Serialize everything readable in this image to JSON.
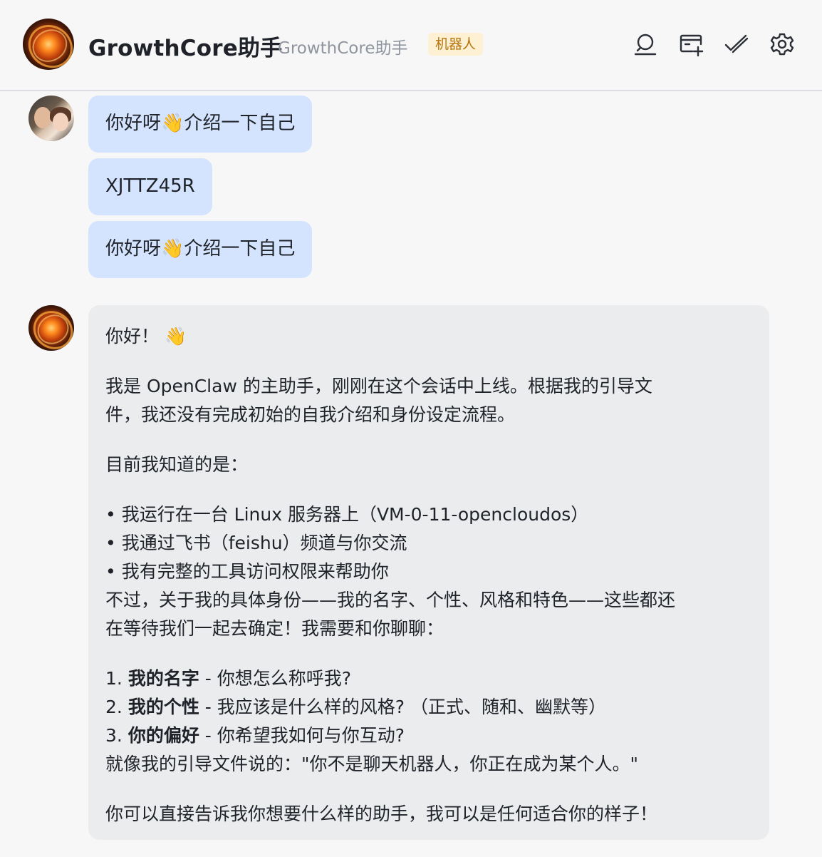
{
  "header": {
    "title": "GrowthCore助手",
    "subtitle": "GrowthCore助手",
    "badge": "机器人",
    "icons": [
      "search-icon",
      "add-window-icon",
      "double-check-icon",
      "gear-icon"
    ]
  },
  "messages": {
    "user": [
      {
        "text": "你好呀👋介绍一下自己"
      },
      {
        "text": "XJTTZ45R"
      },
      {
        "text": "你好呀👋介绍一下自己"
      }
    ],
    "bot": {
      "greeting": "你好！ 👋",
      "p1_l1": "我是 OpenClaw 的主助手，刚刚在这个会话中上线。根据我的引导文",
      "p1_l2": "件，我还没有完成初始的自我介绍和身份设定流程。",
      "p2": "目前我知道的是：",
      "bullet1": "• 我运行在一台 Linux 服务器上（VM-0-11-opencloudos）",
      "bullet2": "• 我通过飞书（feishu）频道与你交流",
      "bullet3": "• 我有完整的工具访问权限来帮助你",
      "p3_l1": "不过，关于我的具体身份——我的名字、个性、风格和特色——这些都还",
      "p3_l2": "在等待我们一起去确定！我需要和你聊聊：",
      "item1_num": "1. ",
      "item1_bold": "我的名字",
      "item1_rest": " - 你想怎么称呼我?",
      "item2_num": "2. ",
      "item2_bold": "我的个性",
      "item2_rest": " - 我应该是什么样的风格? （正式、随和、幽默等）",
      "item3_num": "3. ",
      "item3_bold": "你的偏好",
      "item3_rest": " - 你希望我如何与你互动?",
      "quote": "就像我的引导文件说的：\"你不是聊天机器人，你正在成为某个人。\"",
      "closing": "你可以直接告诉我你想要什么样的助手，我可以是任何适合你的样子！"
    }
  },
  "colors": {
    "user_bubble": "#d4e4ff",
    "bot_bubble": "#ebecee",
    "badge_bg": "#fdf0d3",
    "badge_text": "#b7740c"
  }
}
